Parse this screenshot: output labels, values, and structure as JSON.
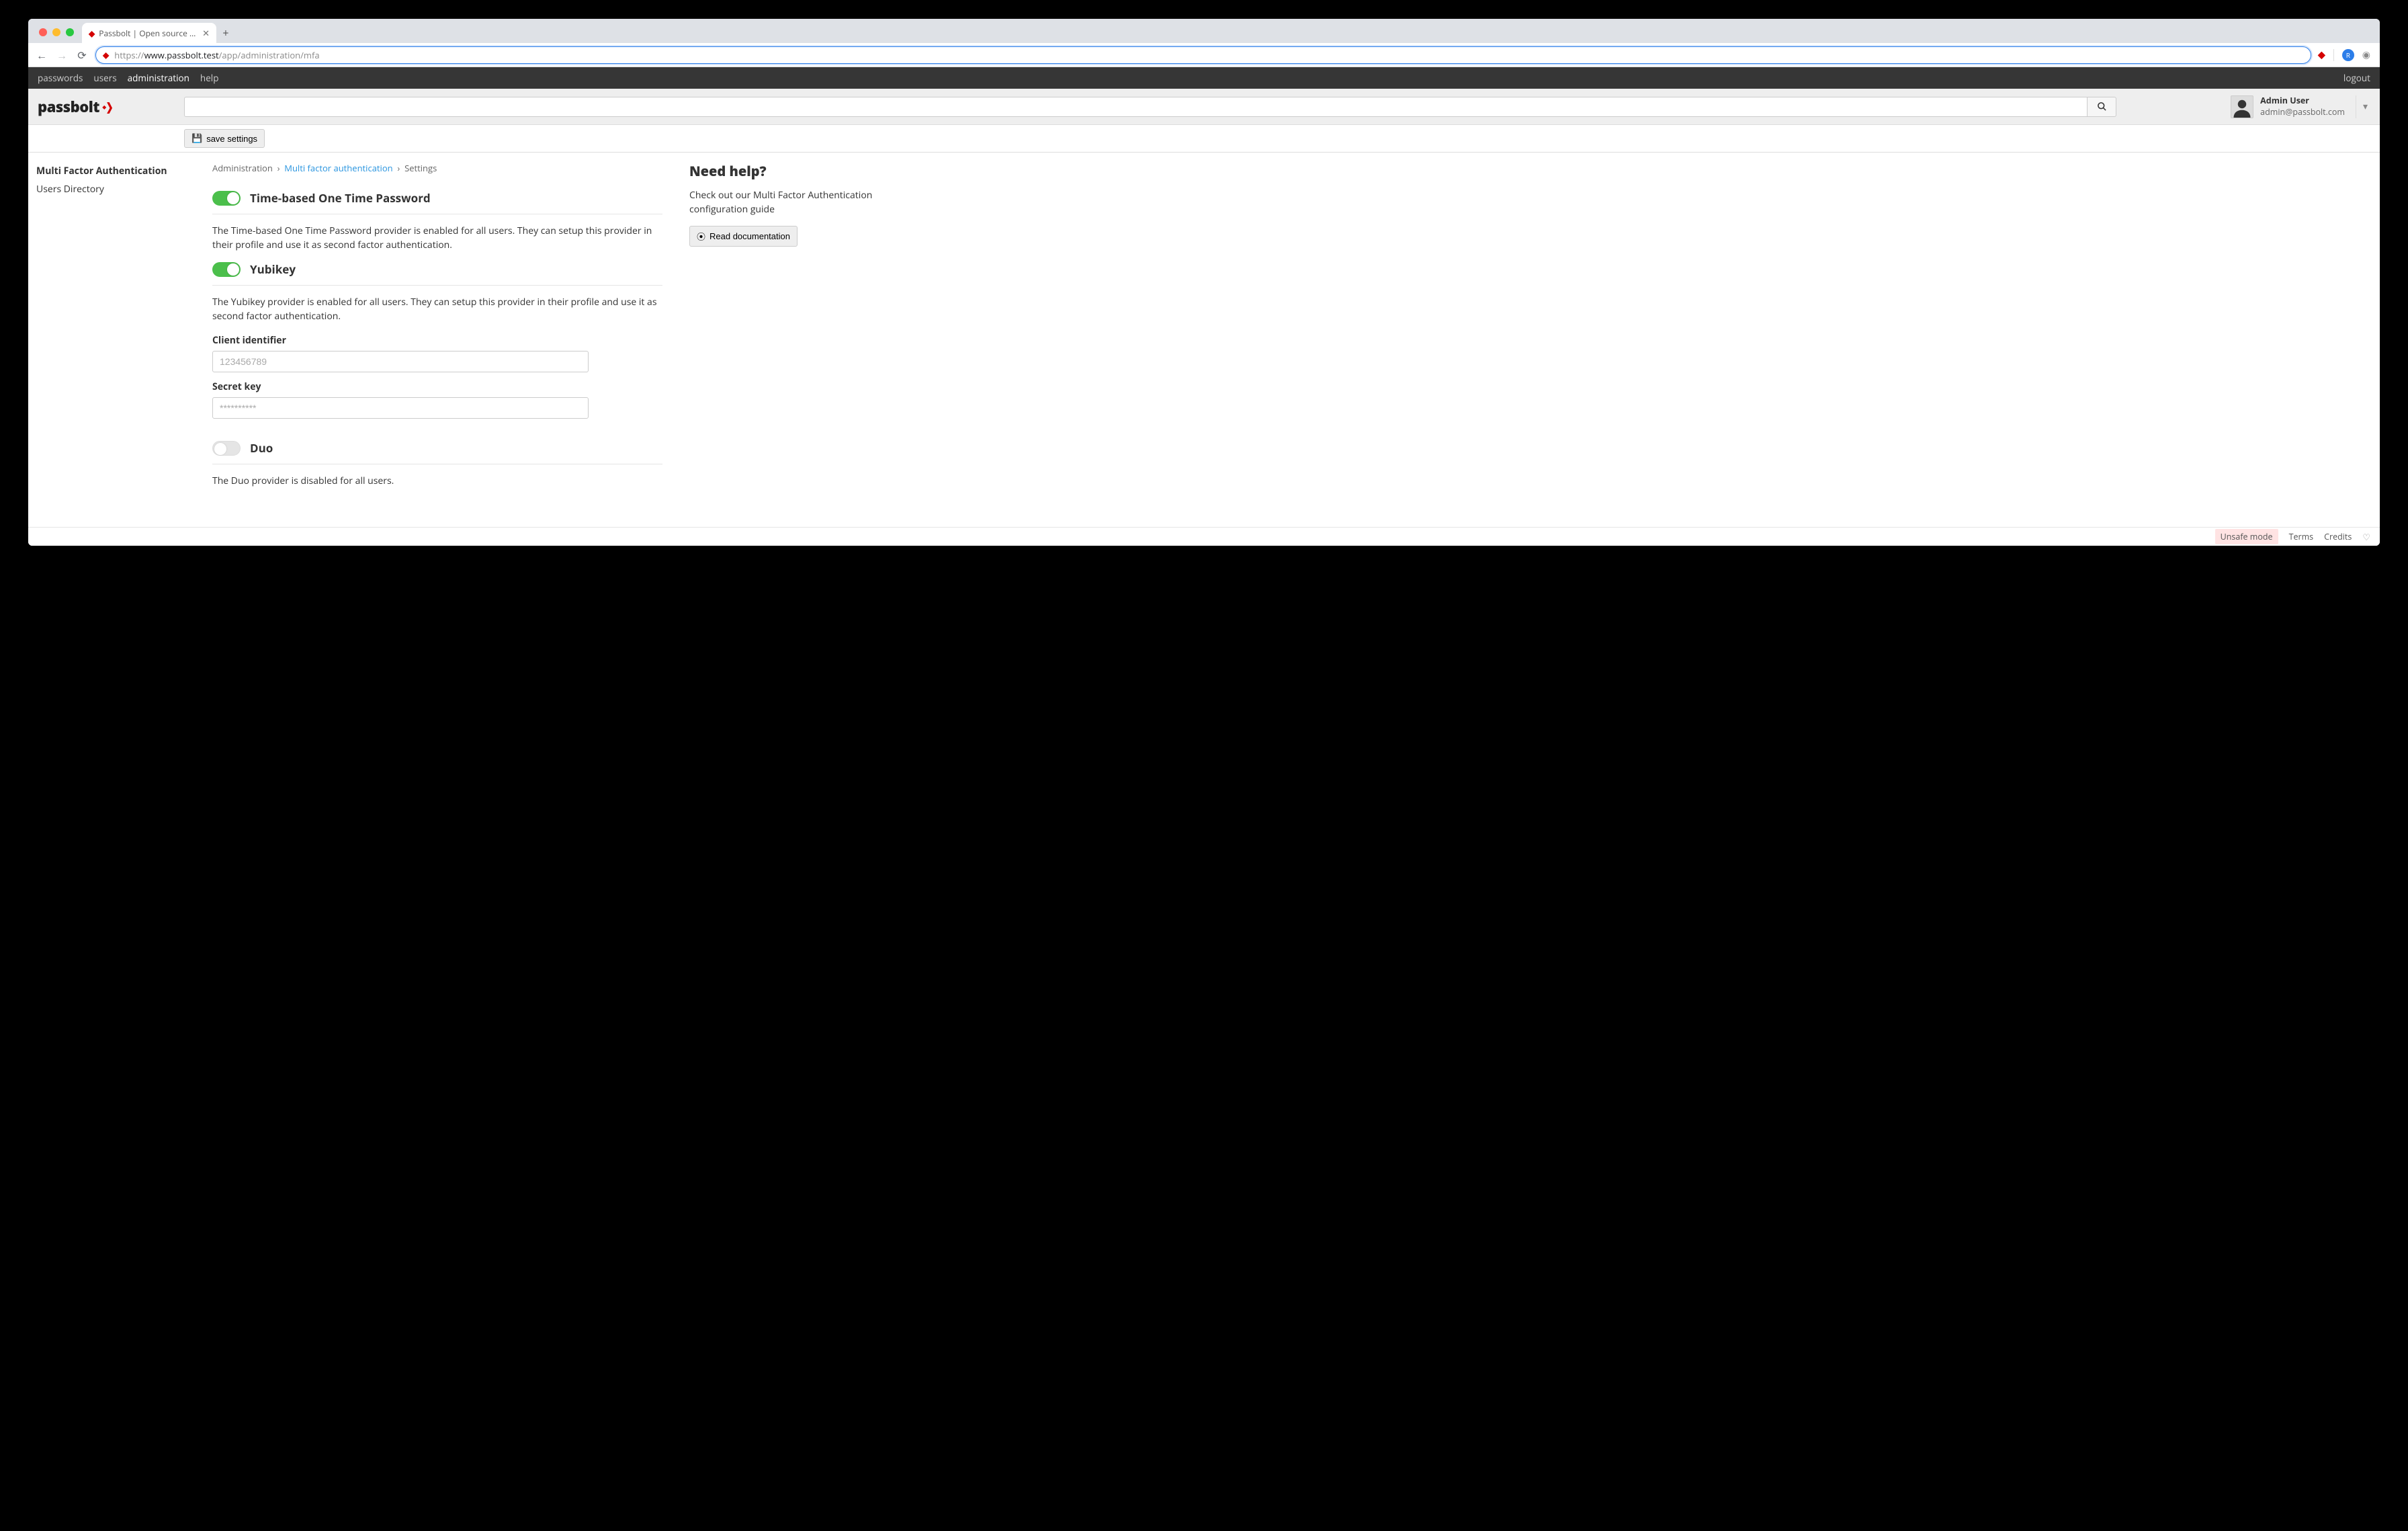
{
  "browser": {
    "tab_title": "Passbolt | Open source passwo",
    "url_prefix": "https://",
    "url_host": "www.passbolt.test",
    "url_path": "/app/administration/mfa",
    "ext_avatar_letter": "R"
  },
  "topnav": {
    "passwords": "passwords",
    "users": "users",
    "administration": "administration",
    "help": "help",
    "logout": "logout"
  },
  "logo": "passbolt",
  "user": {
    "name": "Admin User",
    "email": "admin@passbolt.com"
  },
  "toolbar": {
    "save_settings": "save settings"
  },
  "sidebar": {
    "mfa": "Multi Factor Authentication",
    "users_directory": "Users Directory"
  },
  "breadcrumb": {
    "admin": "Administration",
    "mfa": "Multi factor authentication",
    "settings": "Settings",
    "sep": "›"
  },
  "content": {
    "totp": {
      "title": "Time-based One Time Password",
      "desc": "The Time-based One Time Password provider is enabled for all users. They can setup this provider in their profile and use it as second factor authentication."
    },
    "yubikey": {
      "title": "Yubikey",
      "desc": "The Yubikey provider is enabled for all users. They can setup this provider in their profile and use it as second factor authentication.",
      "client_label": "Client identifier",
      "client_placeholder": "123456789",
      "secret_label": "Secret key",
      "secret_placeholder": "**********"
    },
    "duo": {
      "title": "Duo",
      "desc": "The Duo provider is disabled for all users."
    }
  },
  "help": {
    "title": "Need help?",
    "text": "Check out our Multi Factor Authentication configuration guide",
    "button": "Read documentation"
  },
  "footer": {
    "unsafe": "Unsafe mode",
    "terms": "Terms",
    "credits": "Credits"
  }
}
